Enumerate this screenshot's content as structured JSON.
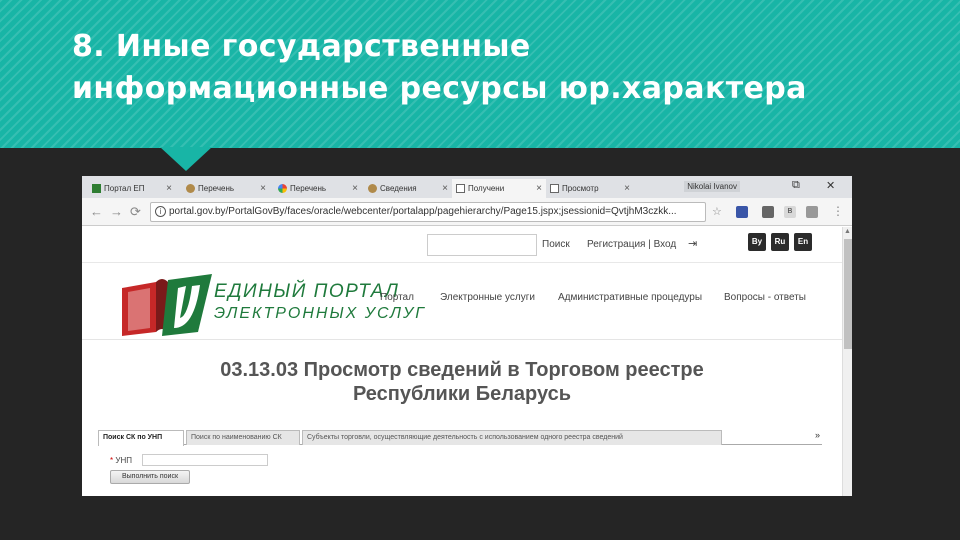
{
  "slide": {
    "title_line1": "8. Иные государственные",
    "title_line2": "информационные ресурсы юр.характера",
    "accent_color": "#18b5a6"
  },
  "browser": {
    "tabs": [
      {
        "label": "Портал ЕП",
        "icon": "portal-logo-icon"
      },
      {
        "label": "Перечень",
        "icon": "brown-globe-icon"
      },
      {
        "label": "Перечень",
        "icon": "google-icon"
      },
      {
        "label": "Сведения",
        "icon": "brown-globe-icon"
      },
      {
        "label": "Получени",
        "icon": "document-icon"
      },
      {
        "label": "Просмотр",
        "icon": "document-icon"
      }
    ],
    "close_glyph": "×",
    "user_name": "Nikolai Ivanov",
    "url": "portal.gov.by/PortalGovBy/faces/oracle/webcenter/portalapp/pagehierarchy/Page15.jspx;jsessionid=QvtjhM3czkk..."
  },
  "portal": {
    "search_label": "Поиск",
    "register_login": "Регистрация | Вход",
    "languages": [
      "By",
      "Ru",
      "En"
    ],
    "logo_line1": "ЕДИНЫЙ ПОРТАЛ",
    "logo_line2": "ЭЛЕКТРОННЫХ УСЛУГ",
    "menu": [
      "Портал",
      "Электронные услуги",
      "Административные процедуры",
      "Вопросы - ответы"
    ],
    "brand_green": "#1f7a3c",
    "brand_red": "#c62828"
  },
  "service": {
    "title_line1": "03.13.03 Просмотр сведений в Торговом реестре",
    "title_line2": "Республики Беларусь",
    "form_tabs": [
      "Поиск СК по УНП",
      "Поиск по наименованию СК",
      "Субъекты торговли, осуществляющие деятельность с использованием одного реестра сведений"
    ],
    "more_glyph": "»",
    "field_label": "УНП",
    "field_required": "*",
    "submit_label": "Выполнить поиск"
  }
}
